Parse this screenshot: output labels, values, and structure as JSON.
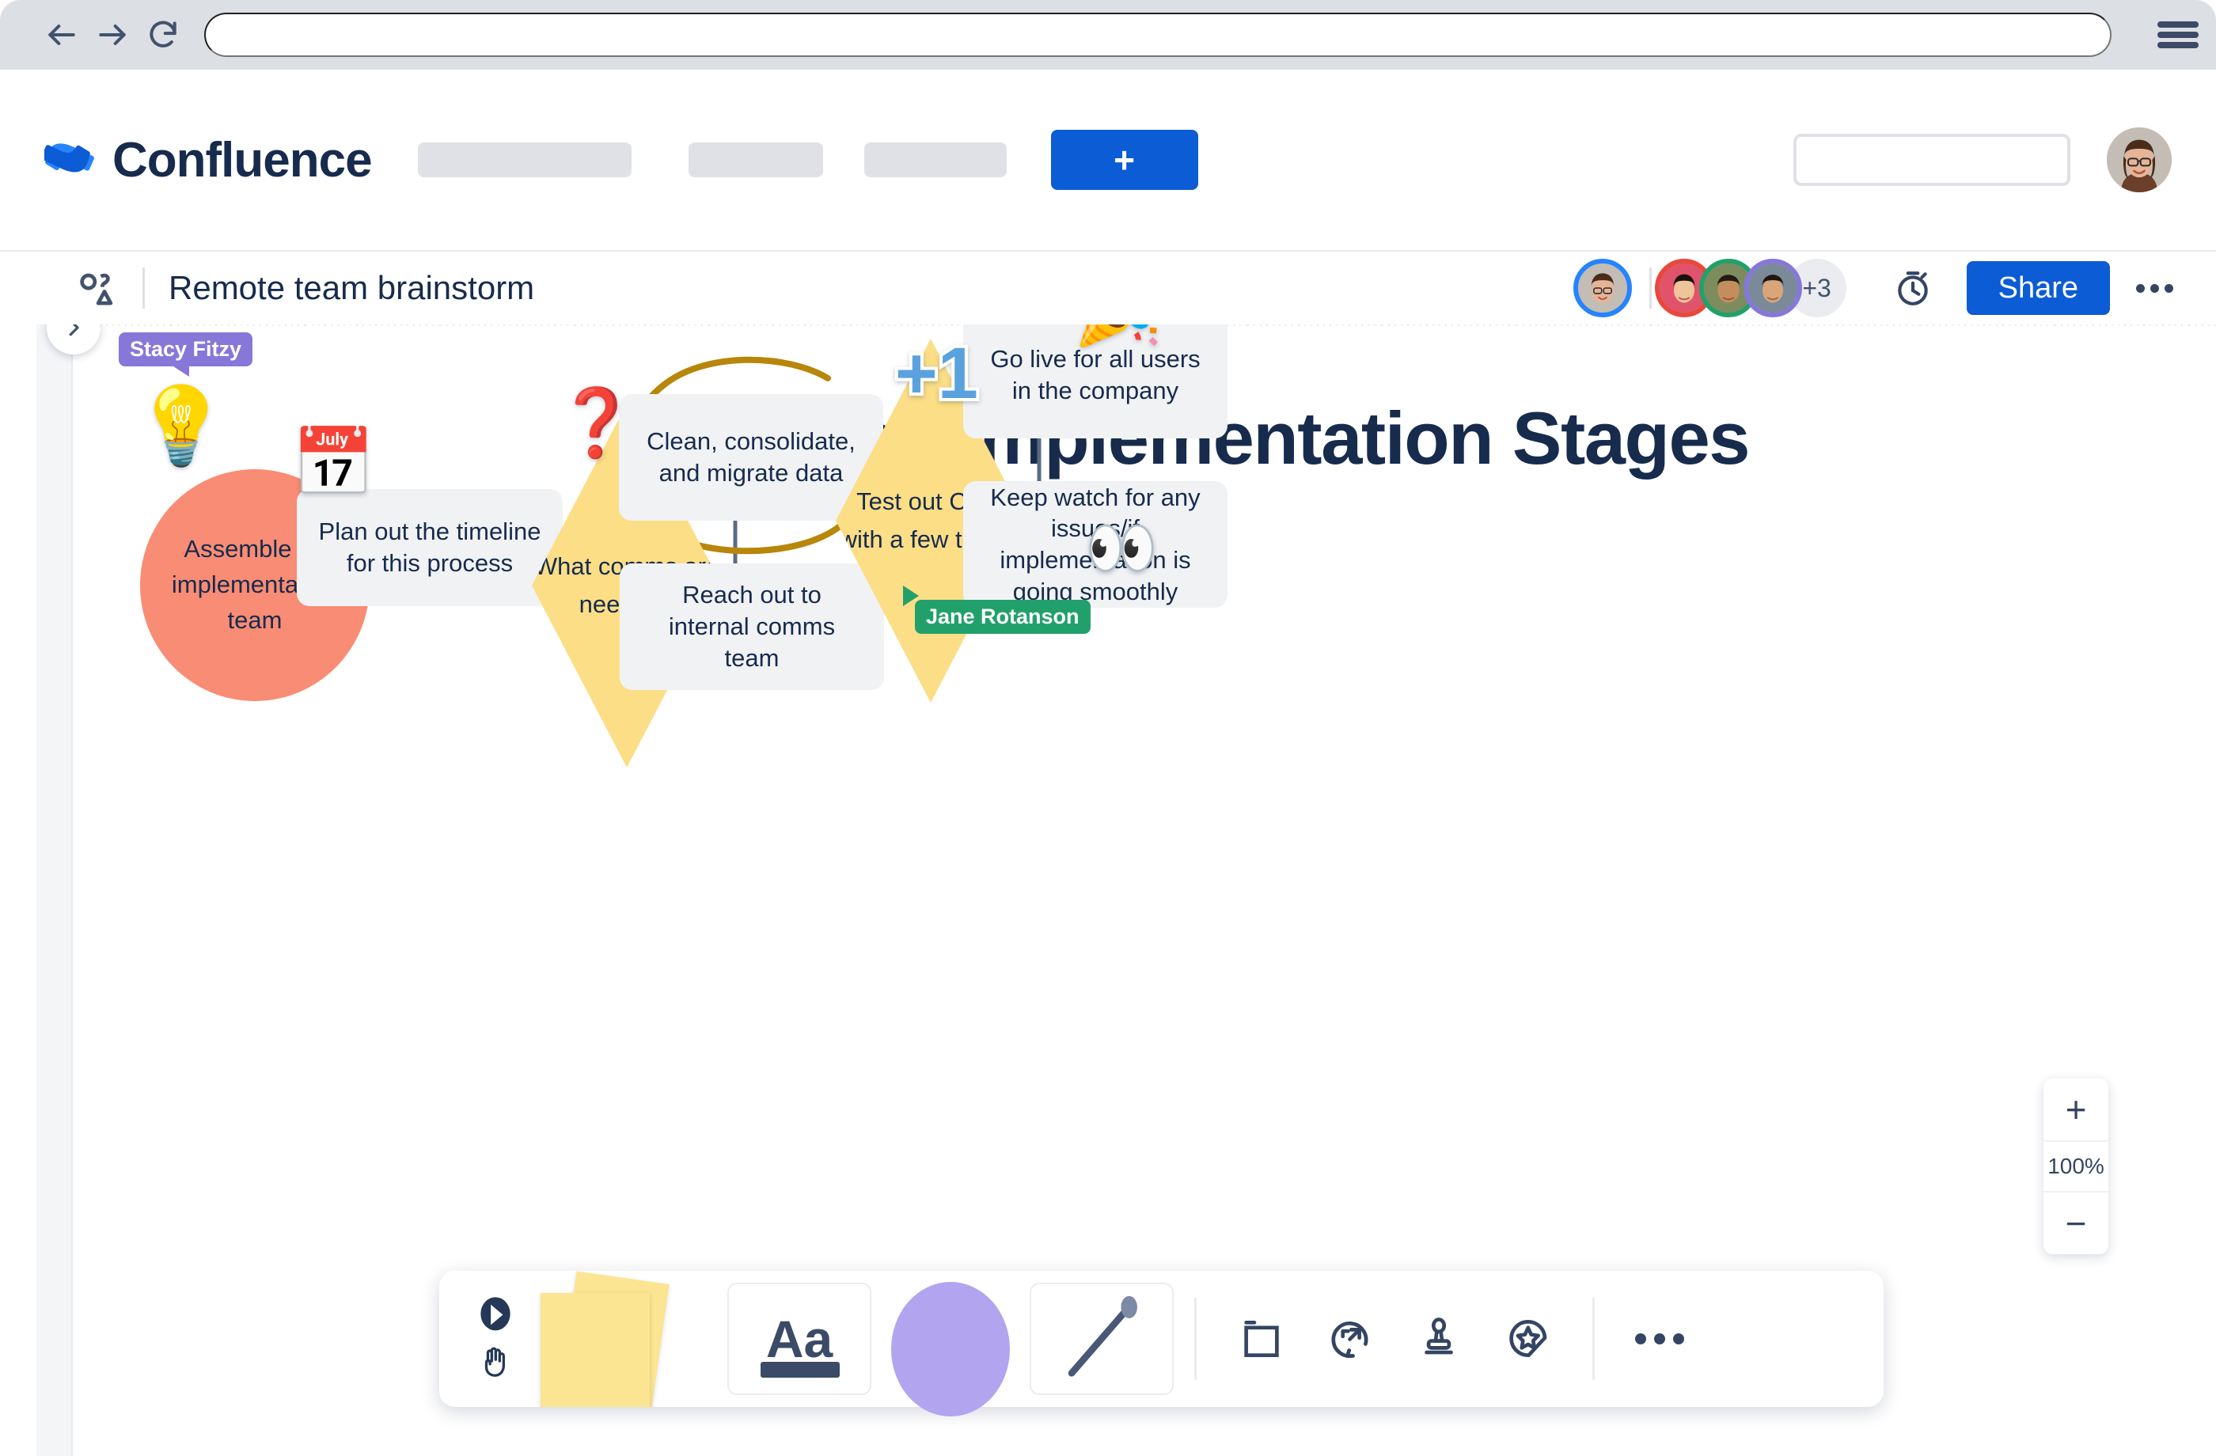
{
  "browser": {
    "back_icon": "arrow-left-icon",
    "forward_icon": "arrow-right-icon",
    "reload_icon": "reload-icon",
    "url_value": "",
    "menu_icon": "hamburger-menu-icon"
  },
  "nav": {
    "brand": "Confluence",
    "logo_icon": "confluence-logo-icon",
    "create_label": "+",
    "search_placeholder": "",
    "search_value": "",
    "search_icon": "search-icon",
    "avatar_icon": "user-avatar",
    "accent_color": "#0b5cd5"
  },
  "board": {
    "icon": "whiteboard-shapes-icon",
    "title": "Remote team brainstorm",
    "presence_overflow": "+3",
    "timer_icon": "timer-icon",
    "share_label": "Share",
    "more_icon": "more-horizontal-icon",
    "sidebar_expand_icon": "chevron-right-icon",
    "presence_colors": [
      "#2684ff",
      "#e8483c",
      "#22a06b",
      "#8777d9"
    ]
  },
  "canvas": {
    "heading": "Expected Implementation Stages",
    "nodes": {
      "assemble": "Assemble an implementation team",
      "plan": "Plan out the timeline for this process",
      "comms": "What comms are needed?",
      "clean": "Clean, consolidate, and migrate data",
      "reach": "Reach out to internal comms team",
      "test": "Test out CRM with a few teams",
      "golive": "Go live for all users in the company",
      "keep": "Keep watch for any issues/if implementation is going smoothly"
    },
    "stickers": {
      "bulb": "💡",
      "calendar": "📅",
      "question": "❓",
      "plusone": "+1",
      "party": "🎉",
      "eyes": "👀"
    },
    "cursors": [
      {
        "name": "Stacy Fitzy",
        "color": "#8777d9"
      },
      {
        "name": "Jane Rotanson",
        "color": "#22a06b"
      }
    ],
    "colors": {
      "circle": "#f98c74",
      "diamond": "#fbde86",
      "box": "#f1f2f4",
      "ink_circle": "#b8860b",
      "text": "#172b4d"
    }
  },
  "toolbar": {
    "select_icon": "cursor-select-icon",
    "hand_icon": "hand-pan-icon",
    "notes_icon": "sticky-notes-icon",
    "text_label": "Aa",
    "text_icon": "text-tool-icon",
    "shape_icon": "shape-tool-icon",
    "line_icon": "line-tool-icon",
    "frame_icon": "frame-icon",
    "jira_icon": "jira-card-icon",
    "stamp_icon": "stamp-icon",
    "sticker_icon": "sticker-icon",
    "more_icon": "more-horizontal-icon"
  },
  "zoom": {
    "in_label": "+",
    "level": "100%",
    "out_label": "−"
  }
}
